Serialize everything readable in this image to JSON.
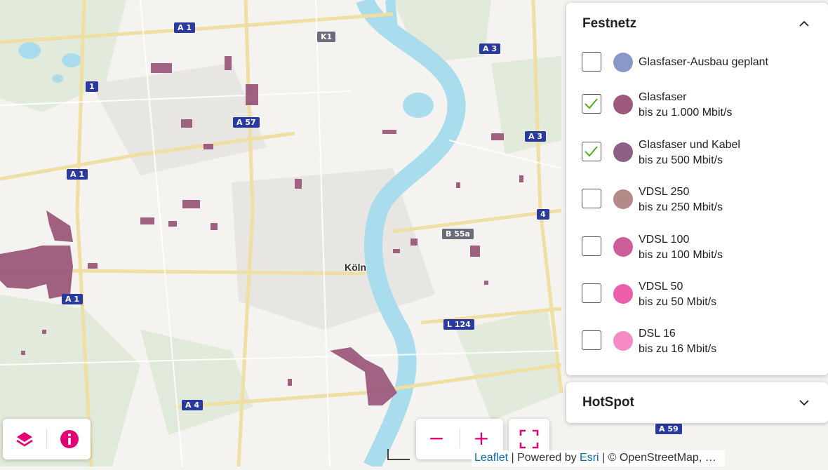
{
  "map": {
    "city_label": "Köln",
    "road_labels": [
      {
        "text": "A 1",
        "kind": "a",
        "name": "road-label-a1-north"
      },
      {
        "text": "K1",
        "kind": "b",
        "name": "road-label-k1"
      },
      {
        "text": "A 3",
        "kind": "a",
        "name": "road-label-a3-north"
      },
      {
        "text": "A 57",
        "kind": "a",
        "name": "road-label-a57"
      },
      {
        "text": "A 1",
        "kind": "a",
        "name": "road-label-a1-west"
      },
      {
        "text": "B 55a",
        "kind": "b",
        "name": "road-label-b55a"
      },
      {
        "text": "A 1",
        "kind": "a",
        "name": "road-label-a1-southwest"
      },
      {
        "text": "L 124",
        "kind": "a",
        "name": "road-label-l124"
      },
      {
        "text": "A 4",
        "kind": "a",
        "name": "road-label-a4"
      },
      {
        "text": "A 59",
        "kind": "a",
        "name": "road-label-a59"
      },
      {
        "text": "A 3",
        "kind": "a",
        "name": "road-label-a3-east"
      },
      {
        "text": "4",
        "kind": "a",
        "name": "road-label-4"
      },
      {
        "text": "1",
        "kind": "a",
        "name": "road-label-1"
      }
    ]
  },
  "festnetz": {
    "title": "Festnetz",
    "expanded": true,
    "items": [
      {
        "line1": "Glasfaser-Ausbau geplant",
        "line2": "",
        "color": "#8a97c9",
        "checked": false
      },
      {
        "line1": "Glasfaser",
        "line2": "bis zu 1.000 Mbit/s",
        "color": "#9e5a7e",
        "checked": true
      },
      {
        "line1": "Glasfaser und Kabel",
        "line2": "bis zu 500 Mbit/s",
        "color": "#8f5f86",
        "checked": true
      },
      {
        "line1": "VDSL 250",
        "line2": "bis zu 250 Mbit/s",
        "color": "#b38a88",
        "checked": false
      },
      {
        "line1": "VDSL 100",
        "line2": "bis zu 100 Mbit/s",
        "color": "#cc5f98",
        "checked": false
      },
      {
        "line1": "VDSL 50",
        "line2": "bis zu 50 Mbit/s",
        "color": "#ea5fa8",
        "checked": false
      },
      {
        "line1": "DSL 16",
        "line2": "bis zu 16 Mbit/s",
        "color": "#f58ac4",
        "checked": false
      }
    ],
    "check_color": "#4caf1e"
  },
  "hotspot": {
    "title": "HotSpot",
    "expanded": false
  },
  "controls": {
    "accent": "#e20074",
    "layers_icon": "layers-icon",
    "info_icon": "info-icon",
    "zoom_out": "−",
    "zoom_in": "+",
    "fullscreen_icon": "fullscreen-icon"
  },
  "attribution": {
    "leaflet": "Leaflet",
    "sep1": " | Powered by ",
    "esri": "Esri",
    "rest": " | © OpenStreetMap, …"
  }
}
